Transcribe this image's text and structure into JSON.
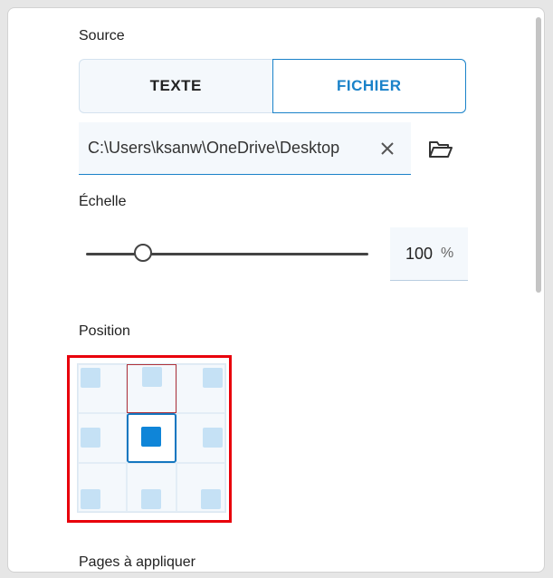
{
  "source": {
    "label": "Source",
    "tabs": [
      {
        "label": "TEXTE",
        "active": false
      },
      {
        "label": "FICHIER",
        "active": true
      }
    ],
    "file_path": "C:\\Users\\ksanw\\OneDrive\\Desktop",
    "clear_icon": "close-icon",
    "browse_icon": "folder-open-icon"
  },
  "scale": {
    "label": "Échelle",
    "value": "100",
    "unit": "%",
    "slider_fraction": 0.18
  },
  "position": {
    "label": "Position",
    "cells": [
      "top-left",
      "top-center",
      "top-right",
      "middle-left",
      "center",
      "middle-right",
      "bottom-left",
      "bottom-center",
      "bottom-right"
    ],
    "selected": "center",
    "hovered": "top-center"
  },
  "pages": {
    "label": "Pages à appliquer"
  },
  "colors": {
    "accent": "#1a82c9",
    "highlight": "#e8000b",
    "selected_square": "#0f85d8",
    "square": "#c5e1f5"
  }
}
